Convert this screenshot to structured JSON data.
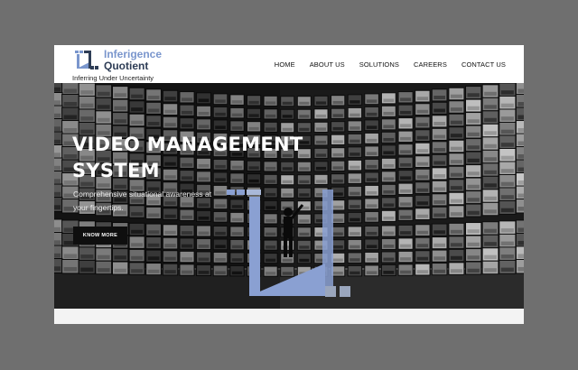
{
  "brand": {
    "line1": "Inferigence",
    "line2": "Quotient",
    "tagline": "Inferring Under Uncertainty",
    "accent_color": "#7a96cd",
    "dark_color": "#2e3d56"
  },
  "nav": {
    "items": [
      "HOME",
      "ABOUT US",
      "SOLUTIONS",
      "CAREERS",
      "CONTACT US"
    ]
  },
  "hero": {
    "title_line1": "VIDEO MANAGEMENT",
    "title_line2": "SYSTEM",
    "subtitle": "Comprehensive situational awareness at your fingertips.",
    "cta_label": "KNOW MORE",
    "overlay_color": "#8aa0d2",
    "background_icon": "video-wall-image"
  }
}
